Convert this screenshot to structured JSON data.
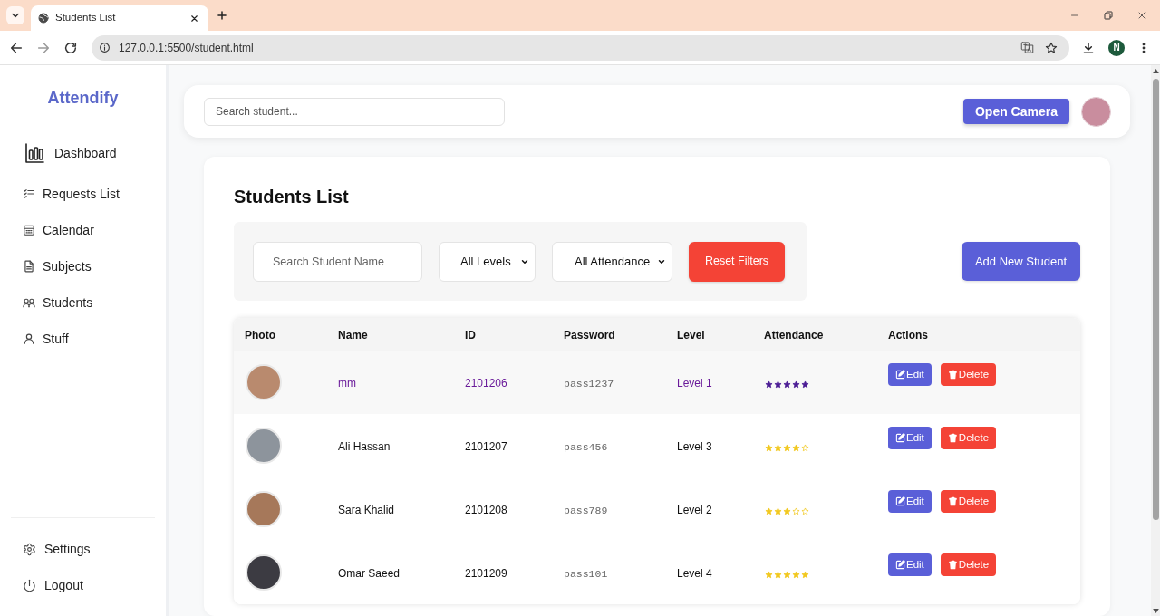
{
  "browser": {
    "tab": {
      "title": "Students List"
    },
    "url": "127.0.0.1:5500/student.html",
    "profile_initial": "N"
  },
  "sidebar": {
    "logo": "Attendify",
    "items": [
      {
        "label": "Dashboard"
      },
      {
        "label": "Requests List"
      },
      {
        "label": "Calendar"
      },
      {
        "label": "Subjects"
      },
      {
        "label": "Students"
      },
      {
        "label": "Stuff"
      }
    ],
    "footer_items": [
      {
        "label": "Settings"
      },
      {
        "label": "Logout"
      }
    ]
  },
  "header": {
    "search": {
      "placeholder": "Search student..."
    },
    "camera_button": "Open Camera"
  },
  "content": {
    "title": "Students List",
    "filters": {
      "search": {
        "placeholder": "Search Student Name"
      },
      "selects": [
        {
          "value": "All Levels"
        },
        {
          "value": "All Attendance"
        }
      ],
      "reset_button": "Reset Filters"
    },
    "add_button": "Add New Student",
    "table": {
      "columns": [
        "Photo",
        "Name",
        "ID",
        "Password",
        "Level",
        "Attendance",
        "Actions"
      ],
      "rows": [
        {
          "selected": true,
          "name": "mm",
          "id": "2101206",
          "password": "pass1237",
          "level": "Level 1",
          "stars": 5,
          "actions": [
            {
              "kind": "edit",
              "label": "Edit"
            },
            {
              "kind": "delete",
              "label": "Delete"
            }
          ]
        },
        {
          "selected": false,
          "name": "Ali Hassan",
          "id": "2101207",
          "password": "pass456",
          "level": "Level 3",
          "stars": 4,
          "actions": [
            {
              "kind": "edit",
              "label": "Edit"
            },
            {
              "kind": "delete",
              "label": "Delete"
            }
          ]
        },
        {
          "selected": false,
          "name": "Sara Khalid",
          "id": "2101208",
          "password": "pass789",
          "level": "Level 2",
          "stars": 3,
          "actions": [
            {
              "kind": "edit",
              "label": "Edit"
            },
            {
              "kind": "delete",
              "label": "Delete"
            }
          ]
        },
        {
          "selected": false,
          "name": "Omar Saeed",
          "id": "2101209",
          "password": "pass101",
          "level": "Level 4",
          "stars": 5,
          "actions": [
            {
              "kind": "edit",
              "label": "Edit"
            },
            {
              "kind": "delete",
              "label": "Delete"
            }
          ]
        }
      ]
    }
  }
}
